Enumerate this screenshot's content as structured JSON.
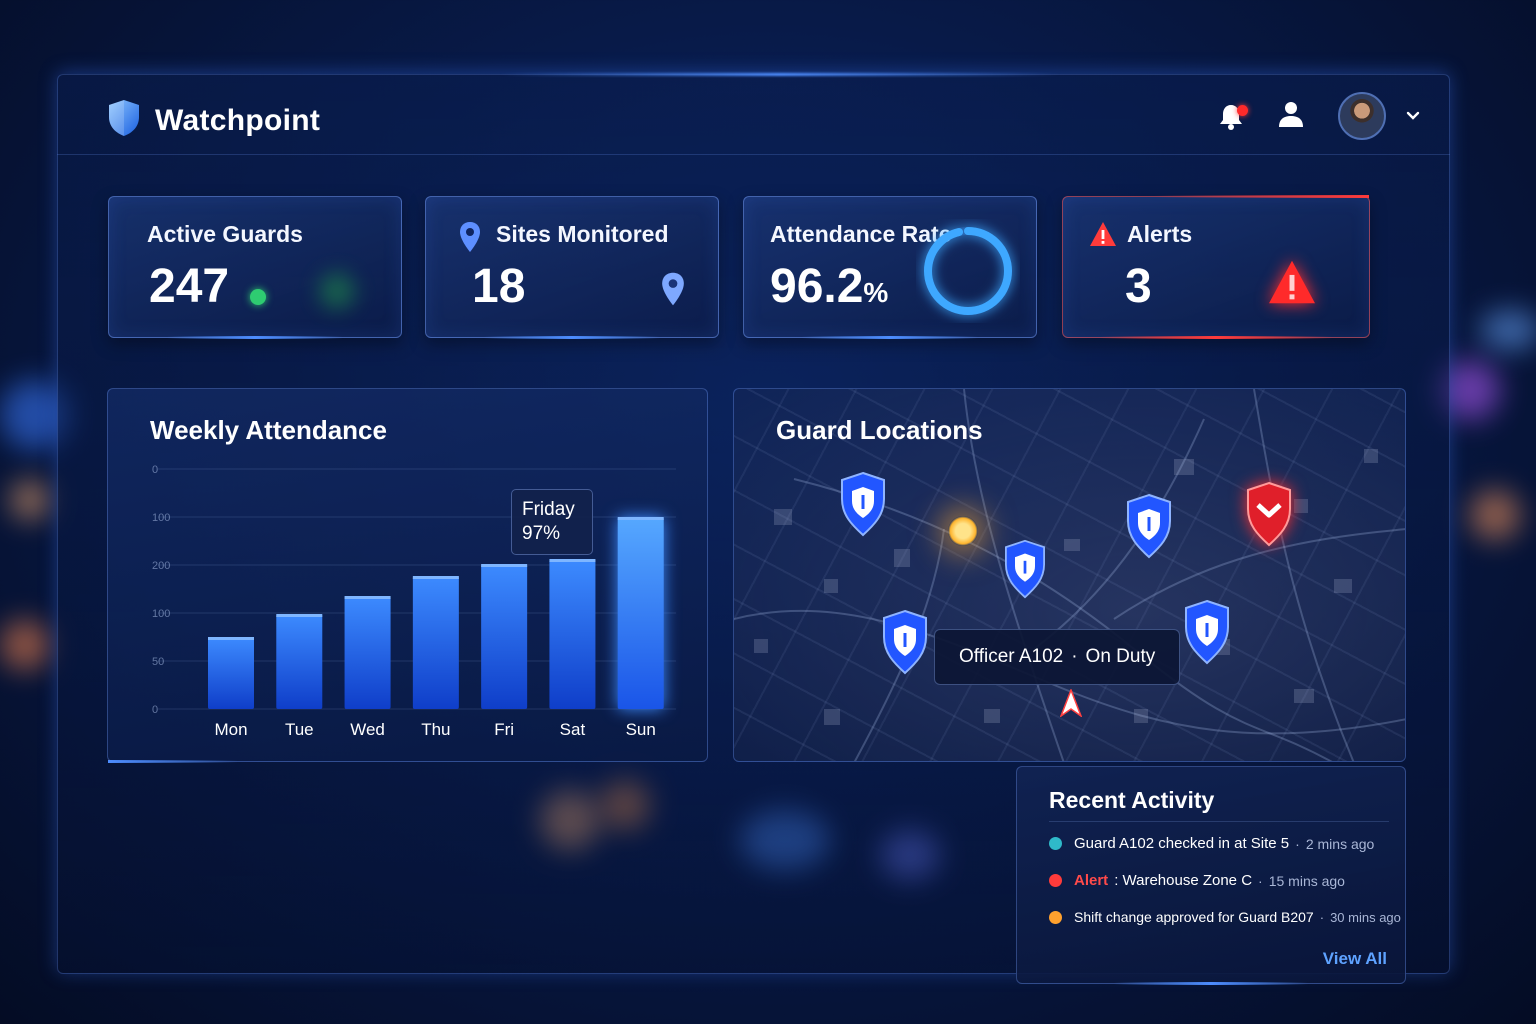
{
  "app": {
    "title": "Watchpoint"
  },
  "header": {
    "notifications_icon": "bell-icon",
    "profile_icon": "user-icon",
    "menu_icon": "chevron-down-icon"
  },
  "stats": {
    "active_guards": {
      "label": "Active Guards",
      "value": "247",
      "status_color": "#2ecc71"
    },
    "sites_monitored": {
      "label": "Sites Monitored",
      "value": "18"
    },
    "attendance_rate": {
      "label": "Attendance Rate",
      "value": "96.2",
      "unit": "%",
      "ring_fraction": 0.962
    },
    "alerts": {
      "label": "Alerts",
      "value": "3",
      "color": "#ff3b3b"
    }
  },
  "weekly_attendance": {
    "title": "Weekly Attendance",
    "tooltip": {
      "day": "Friday",
      "value": "97%"
    }
  },
  "chart_data": {
    "type": "bar",
    "title": "Weekly Attendance",
    "categories": [
      "Mon",
      "Tue",
      "Wed",
      "Thu",
      "Fri",
      "Sat",
      "Sun"
    ],
    "values": [
      72,
      95,
      113,
      133,
      145,
      150,
      192
    ],
    "y_ticks": [
      "0",
      "100",
      "200",
      "100",
      "50",
      "0"
    ],
    "ylim": [
      0,
      240
    ],
    "grid": true
  },
  "guard_locations": {
    "title": "Guard Locations",
    "tooltip": {
      "officer": "Officer A102",
      "separator": "·",
      "status": "On Duty"
    }
  },
  "recent_activity": {
    "title": "Recent Activity",
    "items": [
      {
        "text": "Guard A102 checked in at Site 5",
        "time": "2 mins ago",
        "color": "#2fb9c9"
      },
      {
        "label": "Alert",
        "text": ": Warehouse Zone C",
        "time": "15 mins ago",
        "color": "#ff3b3b"
      },
      {
        "text": "Shift change approved for Guard B207",
        "time": "30 mins ago",
        "color": "#ffa12e"
      }
    ],
    "separator": "·",
    "view_all": "View All"
  },
  "colors": {
    "accent": "#2f7cff",
    "alert": "#ff3b3b",
    "success": "#2ecc71"
  }
}
